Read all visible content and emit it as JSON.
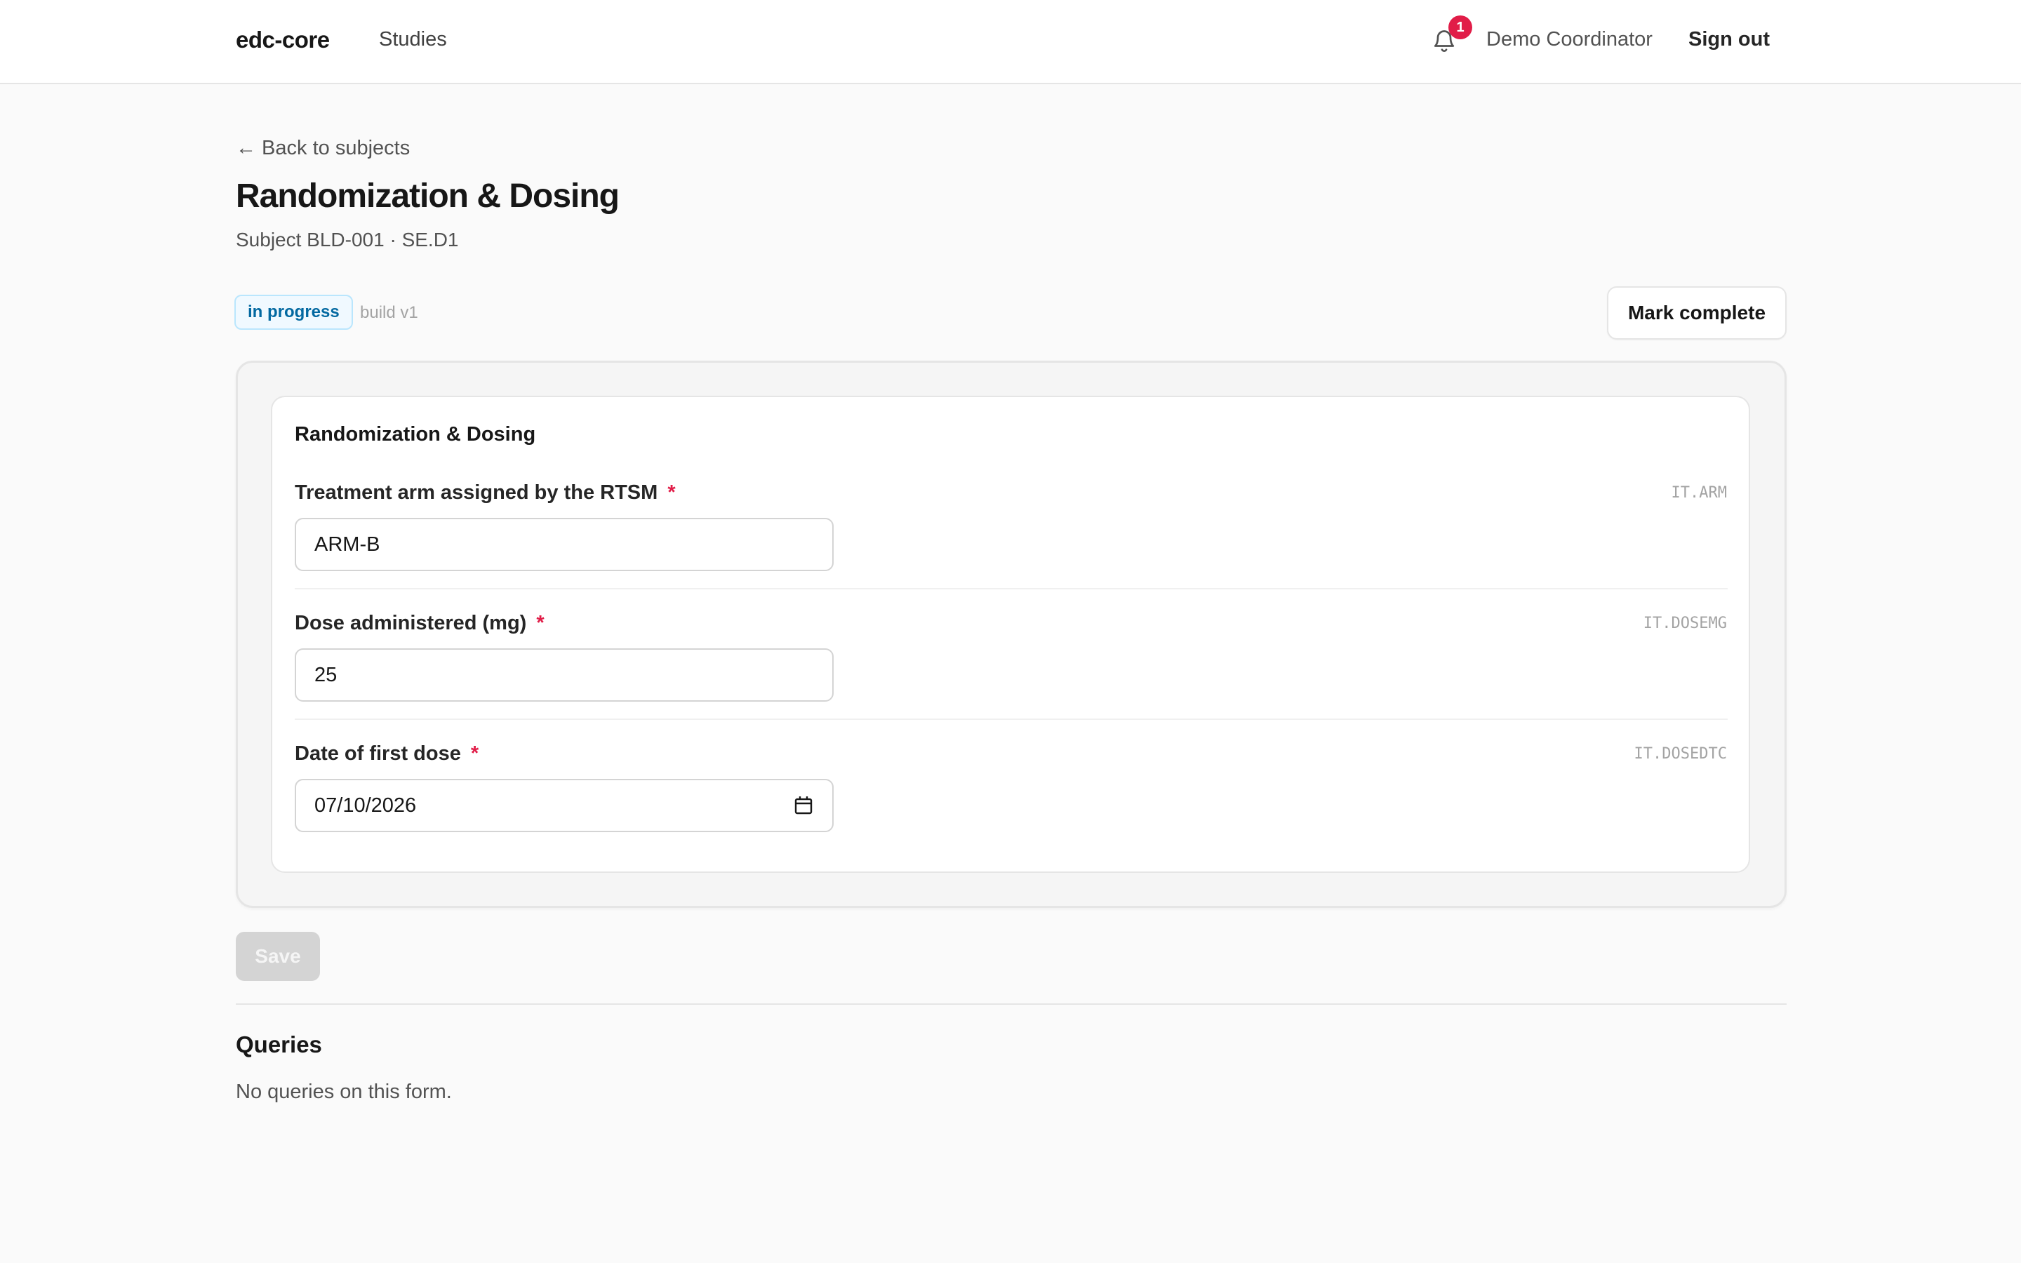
{
  "header": {
    "brand": "edc-core",
    "nav_studies": "Studies",
    "notification_count": "1",
    "user_name": "Demo Coordinator",
    "sign_out": "Sign out"
  },
  "page": {
    "back_link": "← Back to subjects",
    "title": "Randomization & Dosing",
    "subtitle": "Subject BLD-001 · SE.D1",
    "status_badge": "in progress",
    "build": "build v1",
    "mark_complete": "Mark complete"
  },
  "form": {
    "section_title": "Randomization & Dosing",
    "fields": [
      {
        "label": "Treatment arm assigned by the RTSM",
        "required_marker": "*",
        "code": "IT.ARM",
        "value": "ARM-B"
      },
      {
        "label": "Dose administered (mg)",
        "required_marker": "*",
        "code": "IT.DOSEMG",
        "value": "25"
      },
      {
        "label": "Date of first dose",
        "required_marker": "*",
        "code": "IT.DOSEDTC",
        "value": "07/10/2026"
      }
    ],
    "save_label": "Save"
  },
  "queries": {
    "title": "Queries",
    "empty_text": "No queries on this form."
  },
  "colors": {
    "required": "#e11d48",
    "badge_text": "#0369a1",
    "badge_bg": "#f0f9ff",
    "notification_badge": "#e11d48"
  },
  "icons": [
    "bell-icon",
    "arrow-left-icon",
    "calendar-icon"
  ]
}
